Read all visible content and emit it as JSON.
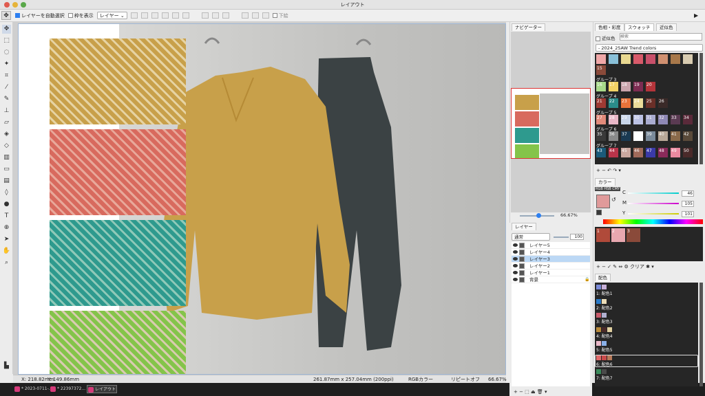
{
  "window": {
    "title": "レイアウト"
  },
  "options": {
    "auto_select": "レイヤーを自動選択",
    "show_frame": "枠を表示",
    "layer_select": "レイヤー",
    "lower": "下絵"
  },
  "status": {
    "x": "X:  218.82mm",
    "y": "Y:  149.86mm",
    "size": "261.87mm x 257.04mm (200ppi)",
    "color_mode": "RGBカラー",
    "repeat": "リピートオフ",
    "zoom": "66.67%"
  },
  "taskbar": {
    "items": [
      "* 2023-0711-...",
      "* 22397372...",
      "レイアウト"
    ]
  },
  "navigator": {
    "tab": "ナビゲーター",
    "zoom": "66.67%"
  },
  "layers": {
    "tab": "レイヤー",
    "blend": "通常",
    "opacity": "100",
    "items": [
      "レイヤー5",
      "レイヤー4",
      "レイヤー3",
      "レイヤー2",
      "レイヤー1",
      "背景"
    ]
  },
  "swatch_panel": {
    "tabs": [
      "色相・彩度",
      "スウォッチ",
      "近似色"
    ],
    "near_label": "近似色",
    "search_placeholder": "検索",
    "palette": "- 2024_25AW Trend colors",
    "row15": "15",
    "groups": [
      {
        "name": "グループ 3",
        "cells": [
          {
            "n": "16",
            "c": "#a8d98a"
          },
          {
            "n": "17",
            "c": "#f2d265"
          },
          {
            "n": "18",
            "c": "#c9a4ac"
          },
          {
            "n": "19",
            "c": "#7d2c52"
          },
          {
            "n": "20",
            "c": "#b4343a"
          }
        ]
      },
      {
        "name": "グループ 4",
        "cells": [
          {
            "n": "21",
            "c": "#9e3a33"
          },
          {
            "n": "22",
            "c": "#2a8c8a"
          },
          {
            "n": "23",
            "c": "#e8733a"
          },
          {
            "n": "24",
            "c": "#eadc9a"
          },
          {
            "n": "25",
            "c": "#6a2f28"
          },
          {
            "n": "26",
            "c": "#3a2a28"
          }
        ]
      },
      {
        "name": "グループ 5",
        "cells": [
          {
            "n": "27",
            "c": "#e28a7a"
          },
          {
            "n": "28",
            "c": "#e9b8c8"
          },
          {
            "n": "29",
            "c": "#c9d6ea"
          },
          {
            "n": "30",
            "c": "#bcc2e4"
          },
          {
            "n": "31",
            "c": "#a9acd0"
          },
          {
            "n": "32",
            "c": "#8e88b4"
          },
          {
            "n": "33",
            "c": "#5a3a52"
          },
          {
            "n": "34",
            "c": "#5a2a3a"
          }
        ]
      },
      {
        "name": "グループ 6",
        "cells": [
          {
            "n": "35",
            "c": "#3a3a3a"
          },
          {
            "n": "36",
            "c": "#8a8a8a"
          },
          {
            "n": "37",
            "c": "#1a3a52"
          },
          {
            "n": "38",
            "c": "#ffffff"
          },
          {
            "n": "39",
            "c": "#7a8a9a"
          },
          {
            "n": "40",
            "c": "#b8a898"
          },
          {
            "n": "41",
            "c": "#8a6a4a"
          },
          {
            "n": "42",
            "c": "#5a4a3a"
          }
        ]
      },
      {
        "name": "グループ 7",
        "cells": [
          {
            "n": "43",
            "c": "#1a5a7a"
          },
          {
            "n": "44",
            "c": "#b8344a"
          },
          {
            "n": "45",
            "c": "#caa8a0"
          },
          {
            "n": "46",
            "c": "#a06a5a"
          },
          {
            "n": "47",
            "c": "#3a3aa8"
          },
          {
            "n": "48",
            "c": "#8a2a5a"
          },
          {
            "n": "49",
            "c": "#ea8aa0"
          },
          {
            "n": "50",
            "c": "#4a2a2a"
          }
        ]
      }
    ],
    "top_row": [
      "#f0a8a8",
      "#89c0d8",
      "#e8d890",
      "#d85a6a",
      "#c8506a",
      "#d09070",
      "#a8784a",
      "#d8cbb0"
    ],
    "row15_color": "#8a4a3a"
  },
  "color_panel": {
    "tab": "カラー",
    "modes": "RGB HSB CMY",
    "labels": [
      "C",
      "M",
      "Y"
    ],
    "values": [
      "46",
      "105",
      "101"
    ],
    "main": "#e09a9a",
    "sub": "#3a3a3a",
    "history": [
      {
        "n": "1",
        "c": "#b04a3a"
      },
      {
        "n": "2",
        "c": "#e8a8b0"
      },
      {
        "n": "3",
        "c": "#8a4a3a"
      }
    ],
    "clear": "クリア"
  },
  "haisho_panel": {
    "tab": "配色",
    "items": [
      {
        "n": "1: 配色1",
        "c": [
          "#7a8ad8",
          "#c8b0d8"
        ]
      },
      {
        "n": "2: 配色2",
        "c": [
          "#2a7ac8",
          "#eadcb8"
        ]
      },
      {
        "n": "3: 配色3",
        "c": [
          "#c85a6a",
          "#b0b0d0"
        ]
      },
      {
        "n": "4: 配色4",
        "c": [
          "#b88a3a",
          "#4a2a2a",
          "#e0d0a0"
        ]
      },
      {
        "n": "5: 配色5",
        "c": [
          "#e8b8c8",
          "#8ab0e8"
        ]
      },
      {
        "n": "6: 配色6",
        "c": [
          "#e06a6a",
          "#c84a4a",
          "#b87a5a"
        ]
      },
      {
        "n": "7: 配色7",
        "c": [
          "#3a8a5a",
          "#4a4a4a"
        ]
      }
    ]
  }
}
